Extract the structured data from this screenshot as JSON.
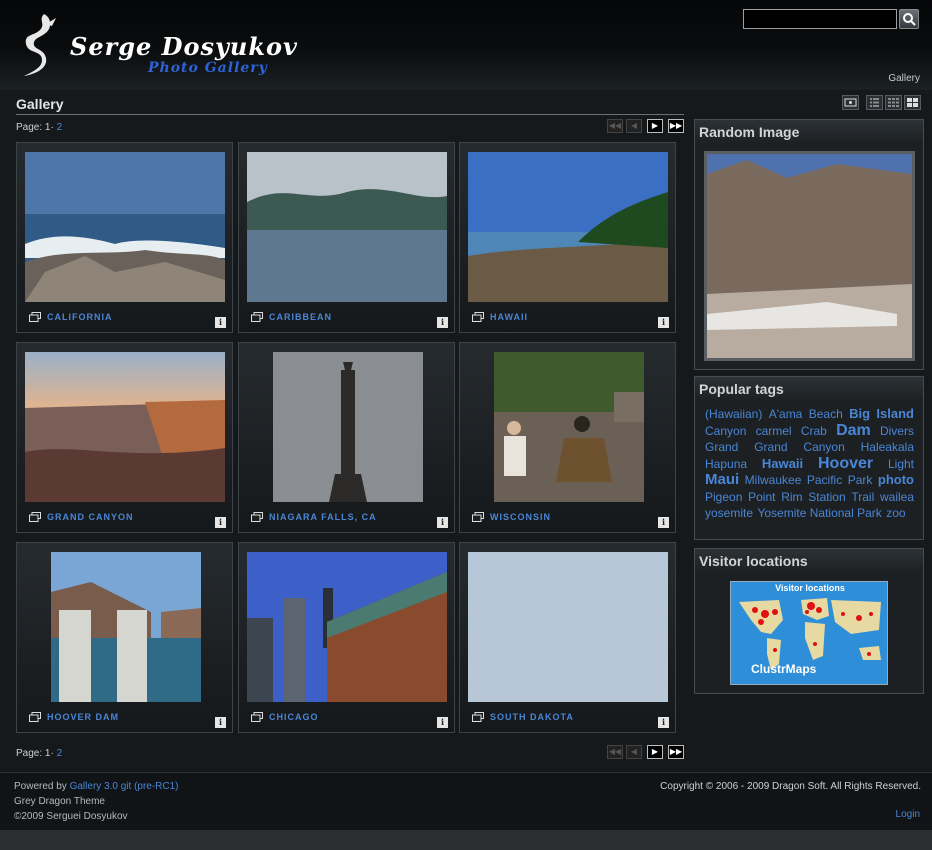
{
  "header": {
    "logo_title": "Serge Dosyukov",
    "logo_subtitle": "Photo Gallery",
    "search_placeholder": "",
    "breadcrumb": "Gallery"
  },
  "main": {
    "title": "Gallery",
    "pager": {
      "label": "Page:",
      "current": "1",
      "separator": "·",
      "next": "2"
    },
    "albums": [
      {
        "label": "CALIFORNIA"
      },
      {
        "label": "CARIBBEAN"
      },
      {
        "label": "HAWAII"
      },
      {
        "label": "GRAND CANYON"
      },
      {
        "label": "NIAGARA FALLS, CA"
      },
      {
        "label": "WISCONSIN"
      },
      {
        "label": "HOOVER DAM"
      },
      {
        "label": "CHICAGO"
      },
      {
        "label": "SOUTH DAKOTA"
      }
    ]
  },
  "sidebar": {
    "random_image_title": "Random Image",
    "popular_tags_title": "Popular tags",
    "tags": [
      "(Hawaiian)",
      "A'ama",
      "Beach",
      "Big",
      "Island",
      "Canyon",
      "carmel",
      "Crab",
      "Dam",
      "Divers",
      "Grand",
      "Grand",
      "Canyon",
      "Haleakala",
      "Hapuna",
      "Hawaii",
      "Hoover",
      "Light",
      "Maui",
      "Milwaukee",
      "Pacific",
      "Park",
      "photo",
      "Pigeon",
      "Point",
      "Rim",
      "Station",
      "Trail",
      "wailea",
      "yosemite",
      "Yosemite National Park",
      "zoo"
    ],
    "visitor_title": "Visitor locations",
    "map_caption": "Visitor locations",
    "map_brand": "ClustrMaps"
  },
  "footer": {
    "powered_prefix": "Powered by ",
    "powered_link": "Gallery 3.0 git (pre-RC1)",
    "theme": "Grey Dragon Theme",
    "author_copyright": "©2009 Serguei Dosyukov",
    "copyright": "Copyright © 2006 - 2009  Dragon Soft. All Rights Reserved.",
    "login": "Login"
  },
  "colors": {
    "link": "#4a86d6",
    "logo_subtitle": "#2d63d8",
    "background": "#15191c"
  }
}
